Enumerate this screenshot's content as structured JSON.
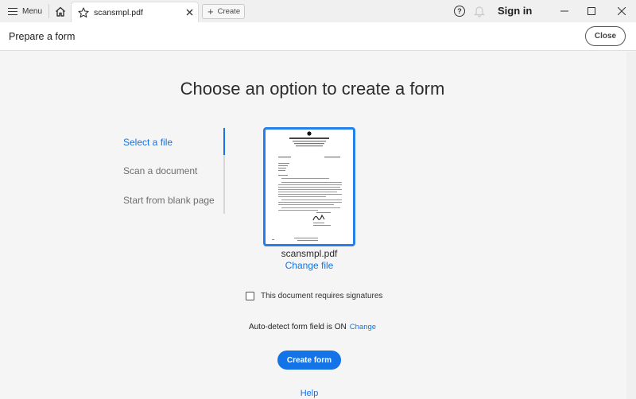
{
  "titlebar": {
    "menu_label": "Menu",
    "tab_title": "scansmpl.pdf",
    "create_label": "Create",
    "help_icon_glyph": "?",
    "signin_label": "Sign in",
    "icons": [
      "hamburger-icon",
      "home-icon",
      "star-icon",
      "close-icon",
      "plus-icon",
      "help-icon",
      "bell-icon",
      "minimize-icon",
      "maximize-icon",
      "window-close-icon"
    ]
  },
  "header": {
    "title": "Prepare a form",
    "close_label": "Close"
  },
  "main": {
    "title": "Choose an option to create a form",
    "options": [
      {
        "label": "Select a file",
        "active": true
      },
      {
        "label": "Scan a document",
        "active": false
      },
      {
        "label": "Start from blank page",
        "active": false
      }
    ],
    "file": {
      "name": "scansmpl.pdf",
      "change_label": "Change file"
    },
    "signature_checkbox": {
      "label": "This document requires signatures",
      "checked": false
    },
    "autodetect": {
      "text": "Auto-detect form field is ON",
      "change_label": "Change"
    },
    "create_button": "Create form",
    "help_link": "Help"
  },
  "colors": {
    "accent": "#1473e6",
    "thumbnail_border": "#2680eb",
    "background": "#f5f5f5"
  }
}
